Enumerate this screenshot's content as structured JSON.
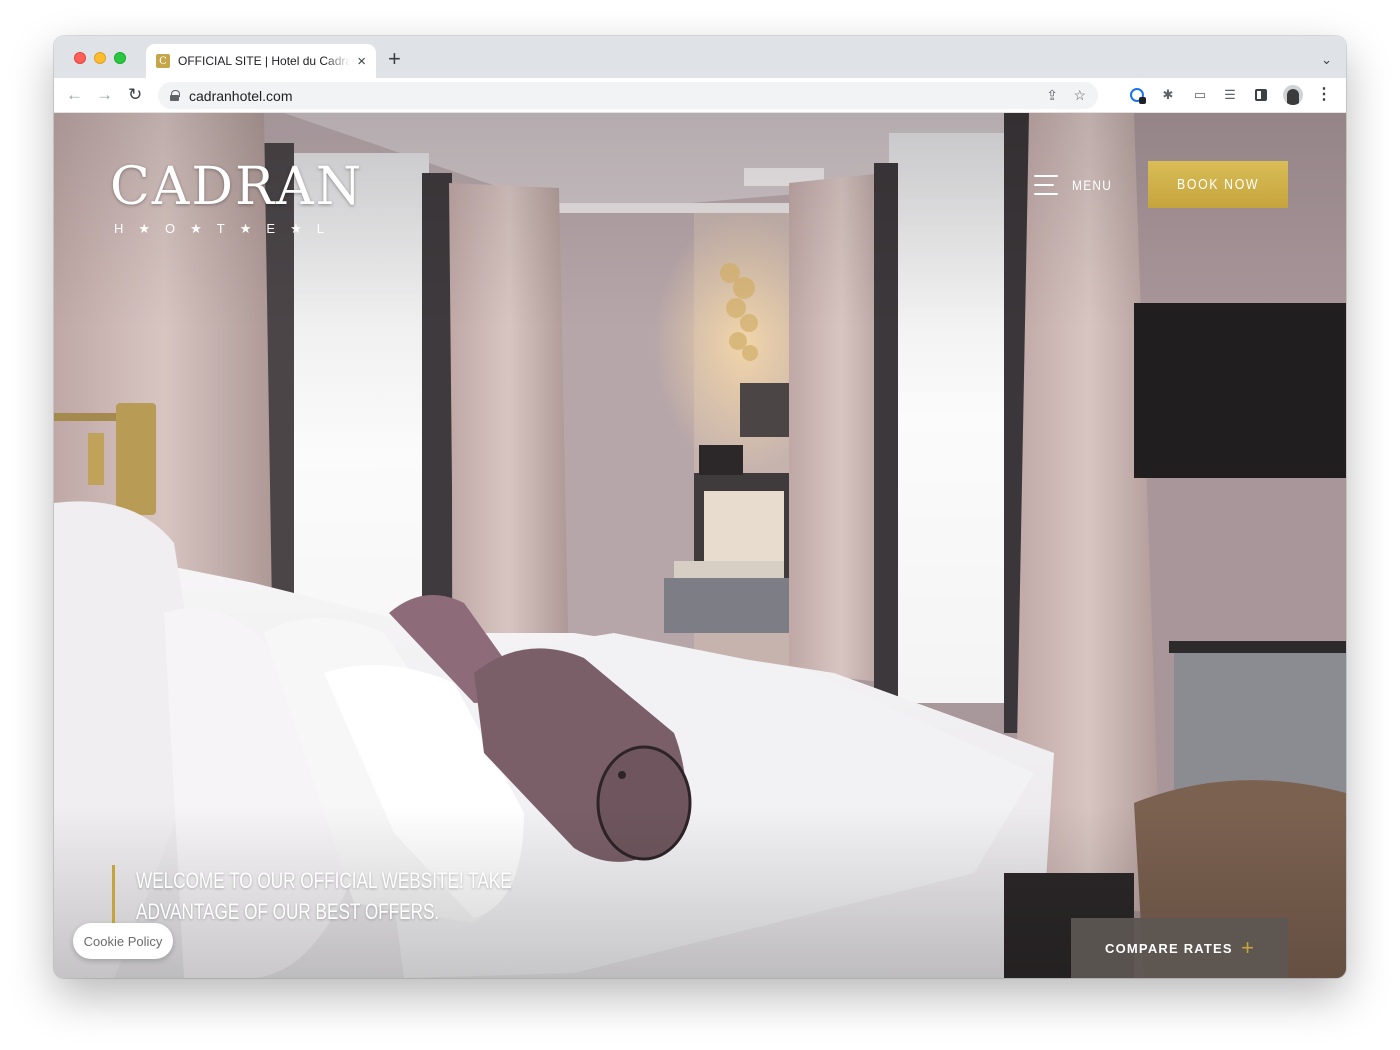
{
  "browser": {
    "tab_title": "OFFICIAL SITE | Hotel du Cadran",
    "favicon_glyph": "C",
    "new_tab_label": "+",
    "close_tab_label": "×",
    "tab_menu_glyph": "⌄",
    "url": "cadranhotel.com",
    "icons": {
      "back": "←",
      "forward": "→",
      "reload": "↻",
      "share": "⇪",
      "bookmark": "☆",
      "extensions": "✱",
      "cast": "▭",
      "reading_list": "☰",
      "more": "⋮"
    }
  },
  "site": {
    "logo": {
      "word": "CADRAN",
      "sub": "H★O★T★E★L"
    },
    "menu_label": "MENU",
    "book_label": "BOOK NOW",
    "welcome_text": "Welcome to our official website! Take advantage of our best offers.",
    "compare_label": "COMPARE RATES",
    "compare_plus": "+",
    "cookie_label": "Cookie Policy"
  },
  "colors": {
    "accent_gold": "#c6a43d",
    "compare_bg": "#5c5652",
    "tab_strip": "#dfe3e8"
  }
}
